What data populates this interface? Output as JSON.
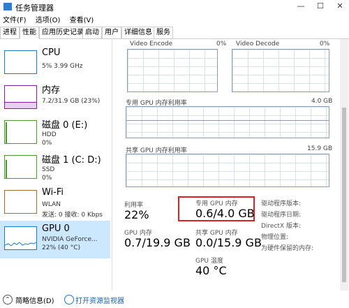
{
  "window": {
    "title": "任务管理器",
    "minimize": "—",
    "maximize": "☐",
    "close": "✕"
  },
  "menu": [
    "文件(F)",
    "选项(O)",
    "查看(V)"
  ],
  "tabs": [
    "进程",
    "性能",
    "应用历史记录",
    "启动",
    "用户",
    "详细信息",
    "服务"
  ],
  "sidebar": {
    "items": [
      {
        "name": "CPU",
        "sub1": "5% 3.99 GHz",
        "sub2": "",
        "sub3": ""
      },
      {
        "name": "内存",
        "sub1": "7.2/31.9 GB (23%)",
        "sub2": "",
        "sub3": ""
      },
      {
        "name": "磁盘 0 (E:)",
        "sub1": "HDD",
        "sub2": "0%",
        "sub3": ""
      },
      {
        "name": "磁盘 1 (C: D:)",
        "sub1": "SSD",
        "sub2": "0%",
        "sub3": ""
      },
      {
        "name": "Wi-Fi",
        "sub1": "WLAN",
        "sub2": "发送: 0 接收: 0 Kbps",
        "sub3": ""
      },
      {
        "name": "GPU 0",
        "sub1": "NVIDIA GeForce...",
        "sub2": "22% (40 °C)",
        "sub3": ""
      }
    ],
    "colors": {
      "cpu": "#1d7bc7",
      "memory": "#8b1fa2",
      "disk": "#4d9b2c",
      "wifi": "#a86b2d",
      "gpu": "#1d7bc7"
    }
  },
  "gpu": {
    "engine_left": "Video Encode",
    "engine_left_pct": "0%",
    "engine_right": "Video Decode",
    "engine_right_pct": "0%",
    "dedicated_label": "专用 GPU 内存利用率",
    "dedicated_max": "4.0 GB",
    "shared_label": "共享 GPU 内存利用率",
    "shared_max": "15.9 GB",
    "stats": {
      "util_label": "利用率",
      "util_value": "22%",
      "ded_label": "专用 GPU 内存",
      "ded_value": "0.6/4.0 GB",
      "gpu_mem_label": "GPU 内存",
      "gpu_mem_value": "0.7/19.9 GB",
      "shared_mem_label": "共享 GPU 内存",
      "shared_mem_value": "0.0/15.9 GB",
      "temp_label": "GPU 温度",
      "temp_value": "40 °C"
    },
    "details": [
      "驱动程序版本:",
      "驱动程序日期:",
      "DirectX 版本:",
      "物理位置:",
      "为硬件保留的内存:"
    ]
  },
  "footer": {
    "less_details": "简略信息(D)",
    "open_monitor": "打开资源监视器"
  }
}
